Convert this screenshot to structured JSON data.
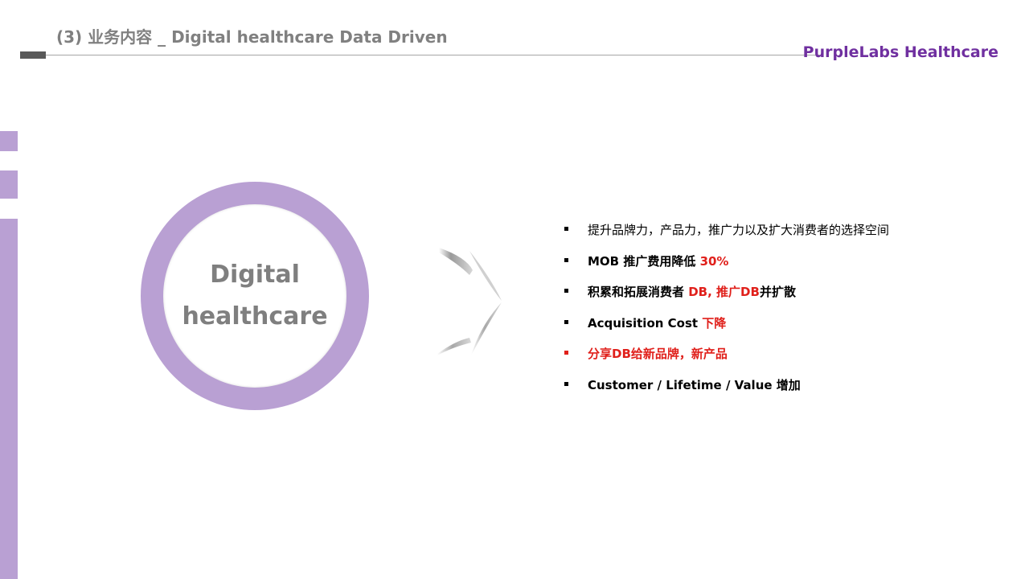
{
  "header": {
    "title": "(3) 业务内容 _ Digital healthcare Data Driven",
    "brand": "PurpleLabs Healthcare"
  },
  "colors": {
    "accent_purple": "#b9a0d3",
    "brand_purple": "#7030a0",
    "highlight_red": "#e0201b",
    "title_gray": "#808080"
  },
  "circle": {
    "line1": "Digital",
    "line2": "healthcare"
  },
  "bullets": [
    {
      "text": "提升品牌力，产品力，推广力以及扩大消费者的选择空间"
    },
    {
      "text": "MOB 推广费用降低 ",
      "highlight": "30%"
    },
    {
      "text": "积累和拓展消费者 ",
      "highlight": "DB, 推广DB",
      "suffix": "并扩散"
    },
    {
      "text": "Acquisition Cost ",
      "highlight": "下降"
    },
    {
      "text": "分享DB给新品牌，新产品"
    },
    {
      "text": "Customer / Lifetime / Value 增加"
    }
  ]
}
